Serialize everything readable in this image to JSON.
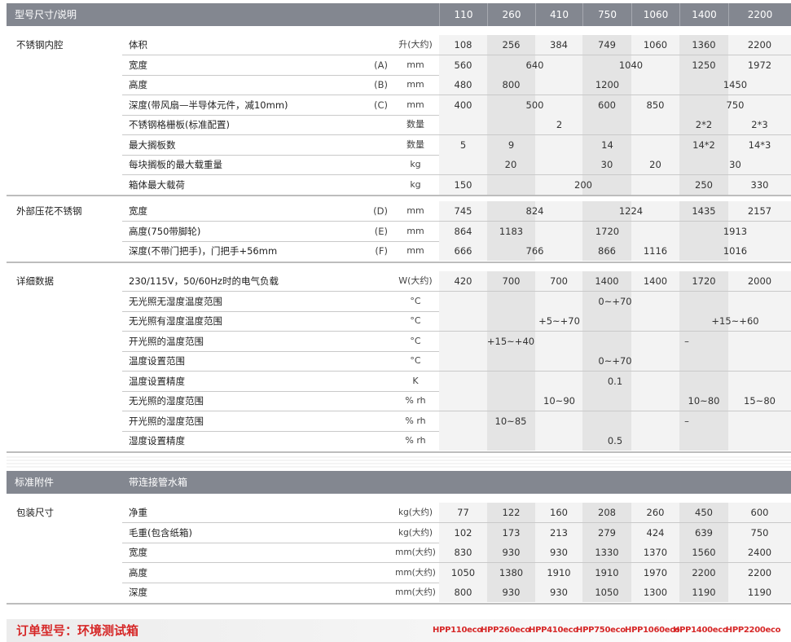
{
  "header": {
    "title": "型号尺寸/说明",
    "models": [
      "110",
      "260",
      "410",
      "750",
      "1060",
      "1400",
      "2200"
    ]
  },
  "sections": [
    {
      "group": "不锈钢内腔",
      "rows": [
        {
          "label": "体积",
          "ref": "",
          "unit": "升(大约)",
          "values": [
            "108",
            "256",
            "384",
            "749",
            "1060",
            "1360",
            "2200"
          ]
        },
        {
          "label": "宽度",
          "ref": "(A)",
          "unit": "mm",
          "values": [
            "560",
            "640",
            "1040",
            "1250",
            "1972"
          ]
        },
        {
          "label": "高度",
          "ref": "(B)",
          "unit": "mm",
          "values": [
            "480",
            "800",
            "1200",
            "1450"
          ]
        },
        {
          "label": "深度(带风扇—半导体元件，减10mm)",
          "ref": "(C)",
          "unit": "mm",
          "values": [
            "400",
            "500",
            "600",
            "850",
            "750"
          ]
        },
        {
          "label": "不锈钢格栅板(标准配置)",
          "ref": "",
          "unit": "数量",
          "values": [
            "2",
            "2*2",
            "2*3"
          ]
        },
        {
          "label": "最大搁板数",
          "ref": "",
          "unit": "数量",
          "values": [
            "5",
            "9",
            "14",
            "14*2",
            "14*3"
          ]
        },
        {
          "label": "每块搁板的最大载重量",
          "ref": "",
          "unit": "kg",
          "values": [
            "20",
            "30",
            "20",
            "30"
          ]
        },
        {
          "label": "箱体最大载荷",
          "ref": "",
          "unit": "kg",
          "values": [
            "150",
            "200",
            "250",
            "330"
          ]
        }
      ]
    },
    {
      "group": "外部压花不锈钢",
      "rows": [
        {
          "label": "宽度",
          "ref": "(D)",
          "unit": "mm",
          "values": [
            "745",
            "824",
            "1224",
            "1435",
            "2157"
          ]
        },
        {
          "label": "高度(750带脚轮)",
          "ref": "(E)",
          "unit": "mm",
          "values": [
            "864",
            "1183",
            "1720",
            "1913"
          ]
        },
        {
          "label": "深度(不带门把手)，门把手+56mm",
          "ref": "(F)",
          "unit": "mm",
          "values": [
            "666",
            "766",
            "866",
            "1116",
            "1016"
          ]
        }
      ]
    },
    {
      "group": "详细数据",
      "rows": [
        {
          "label": "230/115V，50/60Hz时的电气负载",
          "ref": "",
          "unit": "W(大约)",
          "values": [
            "420",
            "700",
            "700",
            "1400",
            "1400",
            "1720",
            "2000"
          ]
        },
        {
          "label": "无光照无湿度温度范围",
          "ref": "",
          "unit": "°C",
          "values": [
            "0~+70"
          ]
        },
        {
          "label": "无光照有湿度温度范围",
          "ref": "",
          "unit": "°C",
          "values": [
            "+5~+70",
            "+15~+60"
          ]
        },
        {
          "label": "开光照的温度范围",
          "ref": "",
          "unit": "°C",
          "values": [
            "+15~+40",
            "–"
          ]
        },
        {
          "label": "温度设置范围",
          "ref": "",
          "unit": "°C",
          "values": [
            "0~+70"
          ]
        },
        {
          "label": "温度设置精度",
          "ref": "",
          "unit": "K",
          "values": [
            "0.1"
          ]
        },
        {
          "label": "无光照的湿度范围",
          "ref": "",
          "unit": "% rh",
          "values": [
            "10~90",
            "10~80",
            "15~80"
          ]
        },
        {
          "label": "开光照的湿度范围",
          "ref": "",
          "unit": "% rh",
          "values": [
            "10~85",
            "–"
          ]
        },
        {
          "label": "湿度设置精度",
          "ref": "",
          "unit": "% rh",
          "values": [
            "0.5"
          ]
        }
      ]
    }
  ],
  "accessory": {
    "label": "标准附件",
    "value": "带连接管水箱"
  },
  "packaging": {
    "group": "包装尺寸",
    "rows": [
      {
        "label": "净重",
        "unit": "kg(大约)",
        "values": [
          "77",
          "122",
          "160",
          "208",
          "260",
          "450",
          "600"
        ]
      },
      {
        "label": "毛重(包含纸箱)",
        "unit": "kg(大约)",
        "values": [
          "102",
          "173",
          "213",
          "279",
          "424",
          "639",
          "750"
        ]
      },
      {
        "label": "宽度",
        "unit": "mm(大约)",
        "values": [
          "830",
          "930",
          "930",
          "1330",
          "1370",
          "1560",
          "2400"
        ]
      },
      {
        "label": "高度",
        "unit": "mm(大约)",
        "values": [
          "1050",
          "1380",
          "1910",
          "1910",
          "1970",
          "2200",
          "2200"
        ]
      },
      {
        "label": "深度",
        "unit": "mm(大约)",
        "values": [
          "800",
          "930",
          "930",
          "1050",
          "1300",
          "1190",
          "1190"
        ]
      }
    ]
  },
  "order": {
    "title": "订单型号：环境测试箱",
    "codes": [
      "HPP110eco",
      "HPP260eco",
      "HPP410eco",
      "HPP750eco",
      "HPP1060eco",
      "HPP1400eco",
      "HPP2200eco"
    ]
  }
}
